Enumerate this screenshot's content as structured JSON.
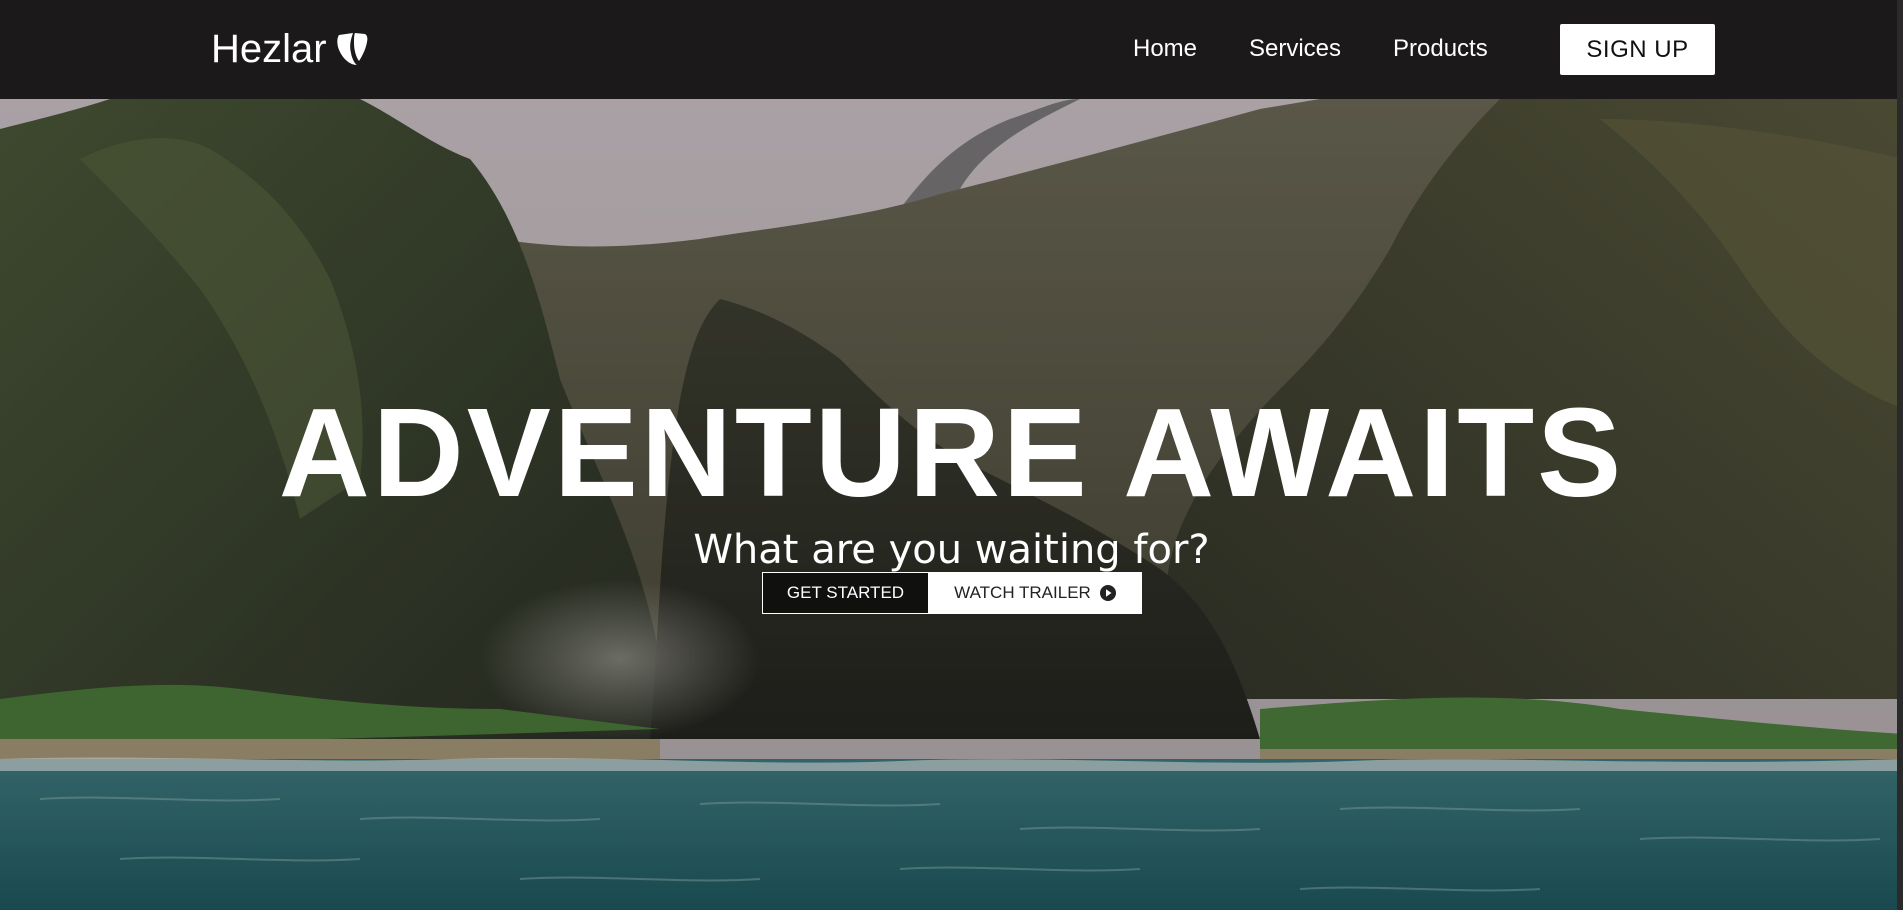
{
  "brand": {
    "name": "Hezlar",
    "logo_icon": "typo3-logo-icon"
  },
  "nav": {
    "links": [
      {
        "label": "Home"
      },
      {
        "label": "Services"
      },
      {
        "label": "Products"
      }
    ],
    "signup_label": "SIGN UP"
  },
  "hero": {
    "title": "ADVENTURE AWAITS",
    "subtitle": "What are you waiting for?",
    "primary_cta": "GET STARTED",
    "secondary_cta": "WATCH TRAILER",
    "secondary_cta_icon": "play-circle-icon",
    "background": "coastal-cliffs-ocean-photo"
  },
  "colors": {
    "nav_bg": "#1b1919",
    "text": "#ffffff",
    "ocean": "#2f6b70",
    "cliff": "#3b3a2c"
  }
}
